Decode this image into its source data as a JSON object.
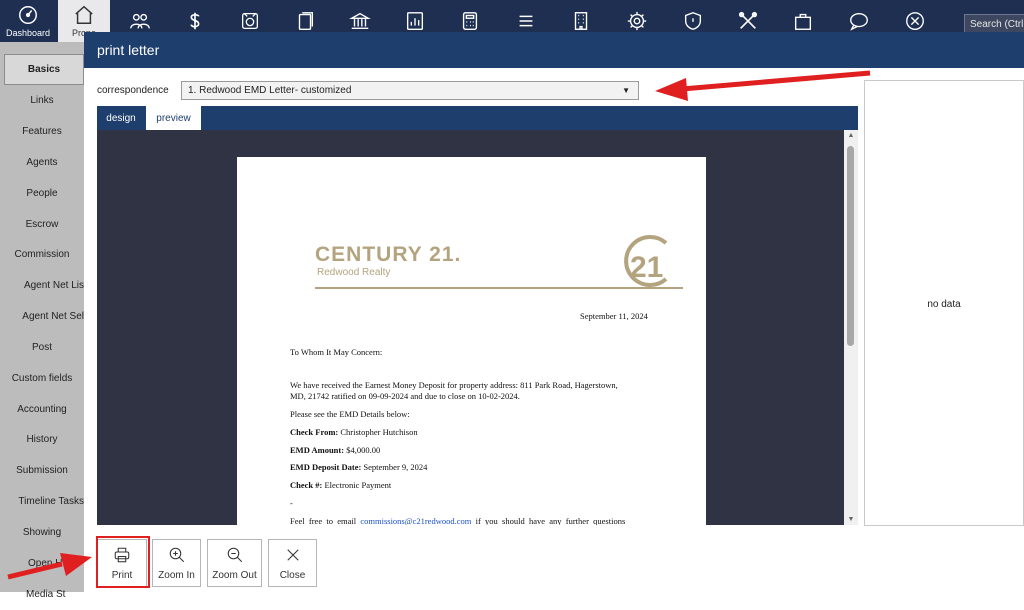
{
  "topnav": {
    "items": [
      {
        "label": "Dashboard",
        "icon": "dashboard-icon"
      },
      {
        "label": "Prope",
        "icon": "home-icon"
      },
      {
        "label": "",
        "icon": "people-icon"
      },
      {
        "label": "",
        "icon": "dollar-icon"
      },
      {
        "label": "",
        "icon": "money-transfer-icon"
      },
      {
        "label": "",
        "icon": "documents-icon"
      },
      {
        "label": "",
        "icon": "bank-icon"
      },
      {
        "label": "",
        "icon": "report-chart-icon"
      },
      {
        "label": "",
        "icon": "calculator-icon"
      },
      {
        "label": "",
        "icon": "list-icon"
      },
      {
        "label": "",
        "icon": "building-icon"
      },
      {
        "label": "",
        "icon": "gear-icon"
      },
      {
        "label": "",
        "icon": "shield-icon"
      },
      {
        "label": "",
        "icon": "tools-icon"
      },
      {
        "label": "",
        "icon": "bag-icon"
      },
      {
        "label": "",
        "icon": "chat-icon"
      },
      {
        "label": "",
        "icon": "close-circle-icon"
      }
    ],
    "search_text": "Search (Ctrl -"
  },
  "sidebar": {
    "items": [
      {
        "label": "Basics"
      },
      {
        "label": "Links"
      },
      {
        "label": "Features"
      },
      {
        "label": "Agents"
      },
      {
        "label": "People"
      },
      {
        "label": "Escrow"
      },
      {
        "label": "Commission"
      },
      {
        "label": "Agent Net Lis"
      },
      {
        "label": "Agent Net Sel"
      },
      {
        "label": "Post"
      },
      {
        "label": "Custom fields"
      },
      {
        "label": "Accounting"
      },
      {
        "label": "History"
      },
      {
        "label": "Submission"
      },
      {
        "label": "Timeline Tasks"
      },
      {
        "label": "Showing"
      },
      {
        "label": "Open H"
      },
      {
        "label": "Media St"
      }
    ]
  },
  "dialog": {
    "title": "print letter",
    "correspondence_label": "correspondence",
    "correspondence_value": "1. Redwood EMD Letter- customized",
    "tabs": {
      "design": "design",
      "preview": "preview"
    },
    "right_panel_text": "no data"
  },
  "letter": {
    "logo_brand": "CENTURY 21.",
    "logo_sub": "Redwood Realty",
    "logo_seal": "21",
    "date": "September 11, 2024",
    "salutation": "To Whom It May Concern:",
    "para1_line1": "We have received the Earnest Money Deposit for property address:  811 Park Road, Hagerstown,",
    "para1_line2": "MD, 21742 ratified on 09-09-2024 and due to close on 10-02-2024.",
    "para2": "Please see the EMD Details below:",
    "check_from_label": "Check From:",
    "check_from_value": " Christopher Hutchison",
    "emd_amount_label": "EMD Amount:",
    "emd_amount_value": " $4,000.00",
    "emd_date_label": "EMD Deposit Date:",
    "emd_date_value": " September 9, 2024",
    "check_no_label": "Check #:",
    "check_no_value": " Electronic Payment",
    "dash": "-",
    "closing_pre": "Feel  free  to  email  ",
    "closing_email": "commissions@c21redwood.com",
    "closing_post": "  if  you  should  have  any  further  questions"
  },
  "buttons": {
    "print": "Print",
    "zoom_in": "Zoom In",
    "zoom_out": "Zoom Out",
    "close": "Close"
  },
  "colors": {
    "nav_bg": "#1e2f52",
    "dialog_header": "#1e3e6e",
    "brand_gold": "#b3a47f",
    "annotation_red": "#e02020"
  }
}
